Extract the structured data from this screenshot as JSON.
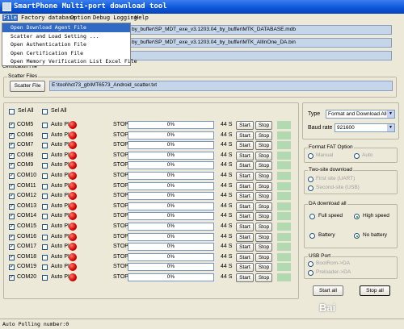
{
  "window": {
    "title": "SmartPhone Multi-port download tool"
  },
  "menu": {
    "items": [
      "File",
      "Factory database",
      "Option",
      "Debug Logging",
      "Help"
    ]
  },
  "file_menu": [
    "Open Download Agent File",
    "Scatter and Load Setting ...",
    "Open Authentication File",
    "Open Certification File",
    "Open Memory Verification List Excel File"
  ],
  "paths": {
    "database": "by_buffer\\SP_MDT_exe_v3.1203.04_by_buffer\\MTK_DATABASE.mdb",
    "download_agent": "by_buffer\\SP_MDT_exe_v3.1203.04_by_buffer\\MTK_AllInOne_DA.bin",
    "auth_label": "Certification File"
  },
  "scatter": {
    "group_label": "Scatter Files",
    "button": "Scatter File",
    "path": "E:\\tool\\hct73_gb\\MT6573_Android_scatter.txt"
  },
  "header": {
    "sel_all_1": "Sel All",
    "sel_all_2": "Sel All"
  },
  "ports": [
    {
      "com": "COM5",
      "auto": "Auto PL",
      "state": "STOP",
      "progress": "0%",
      "time": "44 S"
    },
    {
      "com": "COM6",
      "auto": "Auto PL",
      "state": "STOP",
      "progress": "0%",
      "time": "44 S"
    },
    {
      "com": "COM7",
      "auto": "Auto PL",
      "state": "STOP",
      "progress": "0%",
      "time": "44 S"
    },
    {
      "com": "COM8",
      "auto": "Auto PL",
      "state": "STOP",
      "progress": "0%",
      "time": "44 S"
    },
    {
      "com": "COM9",
      "auto": "Auto PL",
      "state": "STOP",
      "progress": "0%",
      "time": "44 S"
    },
    {
      "com": "COM10",
      "auto": "Auto PL",
      "state": "STOP",
      "progress": "0%",
      "time": "44 S"
    },
    {
      "com": "COM11",
      "auto": "Auto PL",
      "state": "STOP",
      "progress": "0%",
      "time": "44 S"
    },
    {
      "com": "COM12",
      "auto": "Auto PL",
      "state": "STOP",
      "progress": "0%",
      "time": "44 S"
    },
    {
      "com": "COM13",
      "auto": "Auto PL",
      "state": "STOP",
      "progress": "0%",
      "time": "44 S"
    },
    {
      "com": "COM14",
      "auto": "Auto PL",
      "state": "STOP",
      "progress": "0%",
      "time": "44 S"
    },
    {
      "com": "COM15",
      "auto": "Auto PL",
      "state": "STOP",
      "progress": "0%",
      "time": "44 S"
    },
    {
      "com": "COM16",
      "auto": "Auto PL",
      "state": "STOP",
      "progress": "0%",
      "time": "44 S"
    },
    {
      "com": "COM17",
      "auto": "Auto PL",
      "state": "STOP",
      "progress": "0%",
      "time": "44 S"
    },
    {
      "com": "COM18",
      "auto": "Auto PL",
      "state": "STOP",
      "progress": "0%",
      "time": "44 S"
    },
    {
      "com": "COM19",
      "auto": "Auto PL",
      "state": "STOP",
      "progress": "0%",
      "time": "44 S"
    },
    {
      "com": "COM20",
      "auto": "Auto PL",
      "state": "STOP",
      "progress": "0%",
      "time": "44 S"
    }
  ],
  "row_buttons": {
    "start": "Start",
    "stop": "Stop"
  },
  "type": {
    "label": "Type",
    "value": "Format and Download All",
    "baud_label": "Baud rate",
    "baud_value": "921600"
  },
  "format_fat": {
    "label": "Format FAT Option",
    "manual": "Manual",
    "auto": "Auto"
  },
  "two_site": {
    "label": "Two-site download",
    "first": "First site (UART)",
    "second": "Second-site (USB)"
  },
  "da": {
    "label": "DA download all",
    "full_speed": "Full speed",
    "high_speed": "High speed",
    "battery": "Battery",
    "no_battery": "No battery"
  },
  "usb": {
    "label": "USB Port",
    "bootrom": "BootRom->DA",
    "preloader": "Preloader->DA"
  },
  "actions": {
    "start_all": "Start all",
    "stop_all": "Stop all"
  },
  "status": {
    "text": "Auto Polling number:0"
  },
  "watermark": "Bai"
}
